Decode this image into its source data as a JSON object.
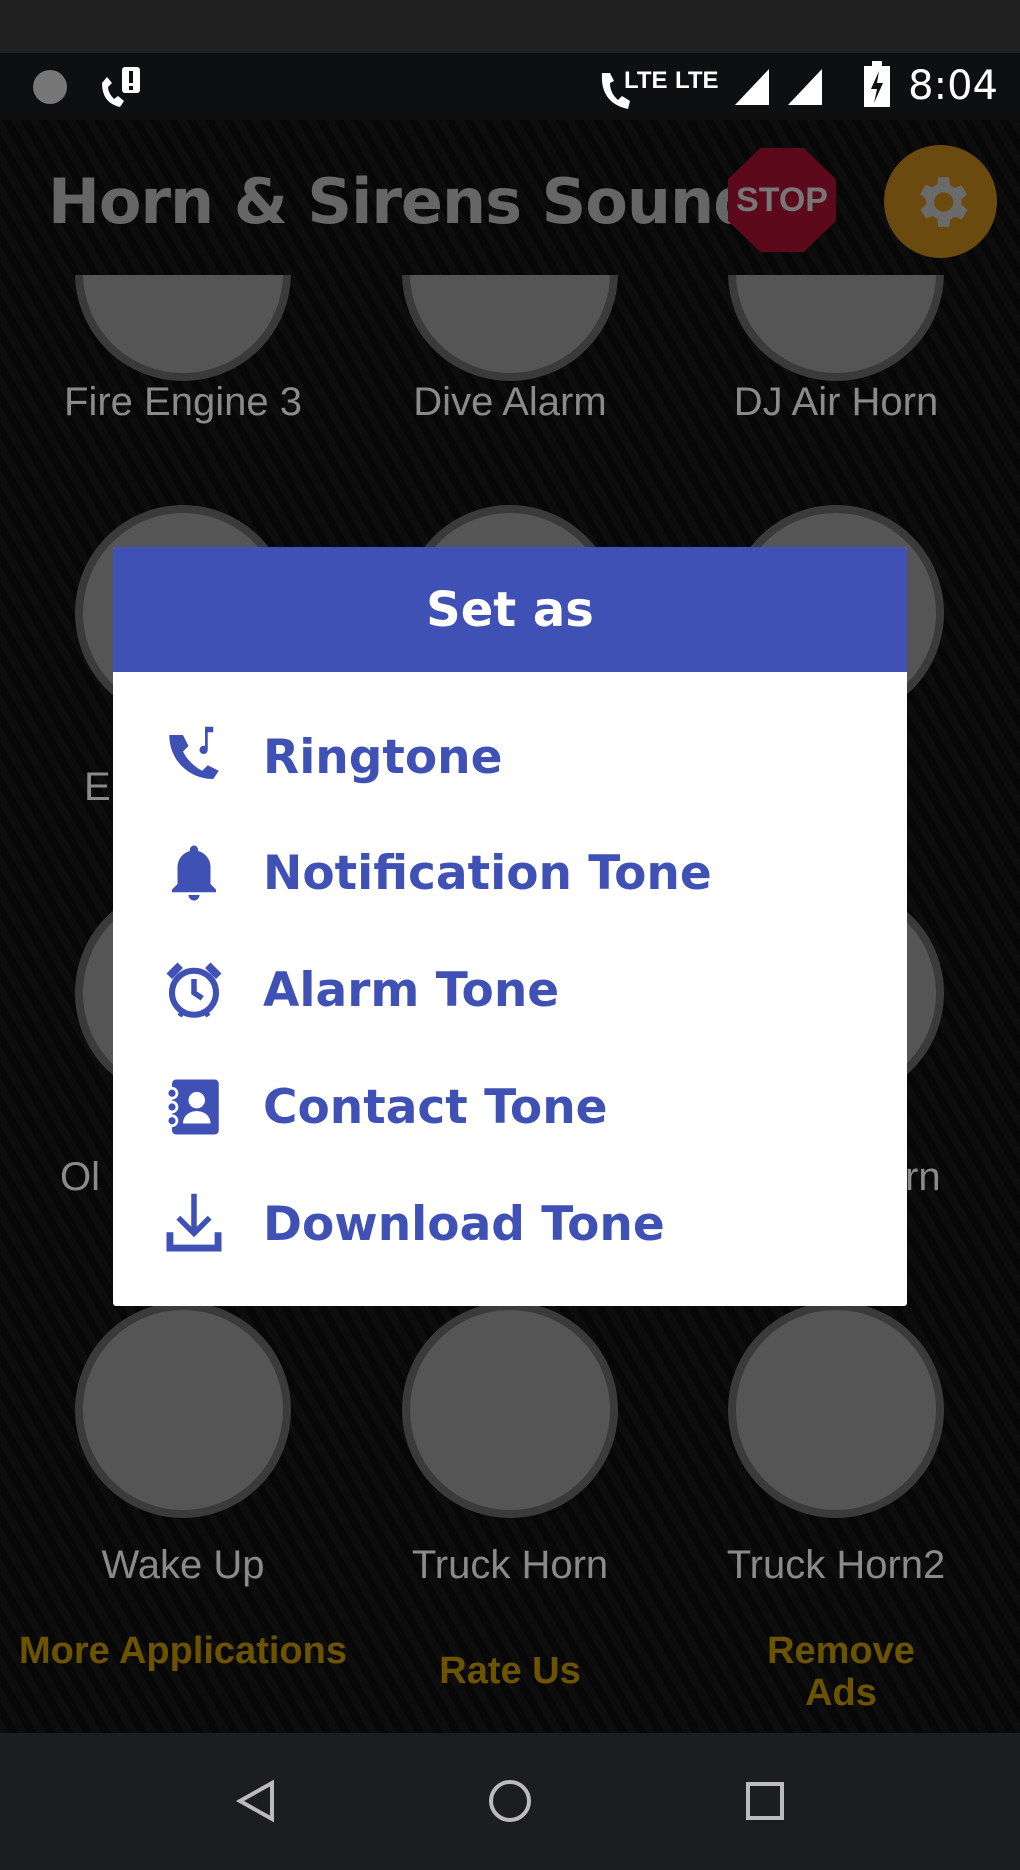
{
  "status_bar": {
    "time": "8:04",
    "lte1": "LTE",
    "lte2": "LTE"
  },
  "header": {
    "title": "Horn & Sirens Sound",
    "stop_label": "STOP"
  },
  "grid": {
    "row1": [
      "Fire Engine 3",
      "Dive Alarm",
      "DJ Air Horn"
    ],
    "row2_partial": [
      "Eu"
    ],
    "row3_partial": [
      "Ol",
      "rn"
    ],
    "row4": [
      "Wake Up",
      "Truck Horn",
      "Truck Horn2"
    ]
  },
  "footer_links": [
    "More Applications",
    "Rate Us",
    "Remove Ads"
  ],
  "dialog": {
    "title": "Set as",
    "items": [
      {
        "label": "Ringtone",
        "icon": "phone-music-icon"
      },
      {
        "label": "Notification Tone",
        "icon": "bell-icon"
      },
      {
        "label": "Alarm Tone",
        "icon": "alarm-clock-icon"
      },
      {
        "label": "Contact Tone",
        "icon": "contact-book-icon"
      },
      {
        "label": "Download Tone",
        "icon": "download-icon"
      }
    ]
  },
  "colors": {
    "accent": "#3f51b5",
    "dialog_bg": "#ffffff",
    "link_gold": "#6b5300"
  }
}
